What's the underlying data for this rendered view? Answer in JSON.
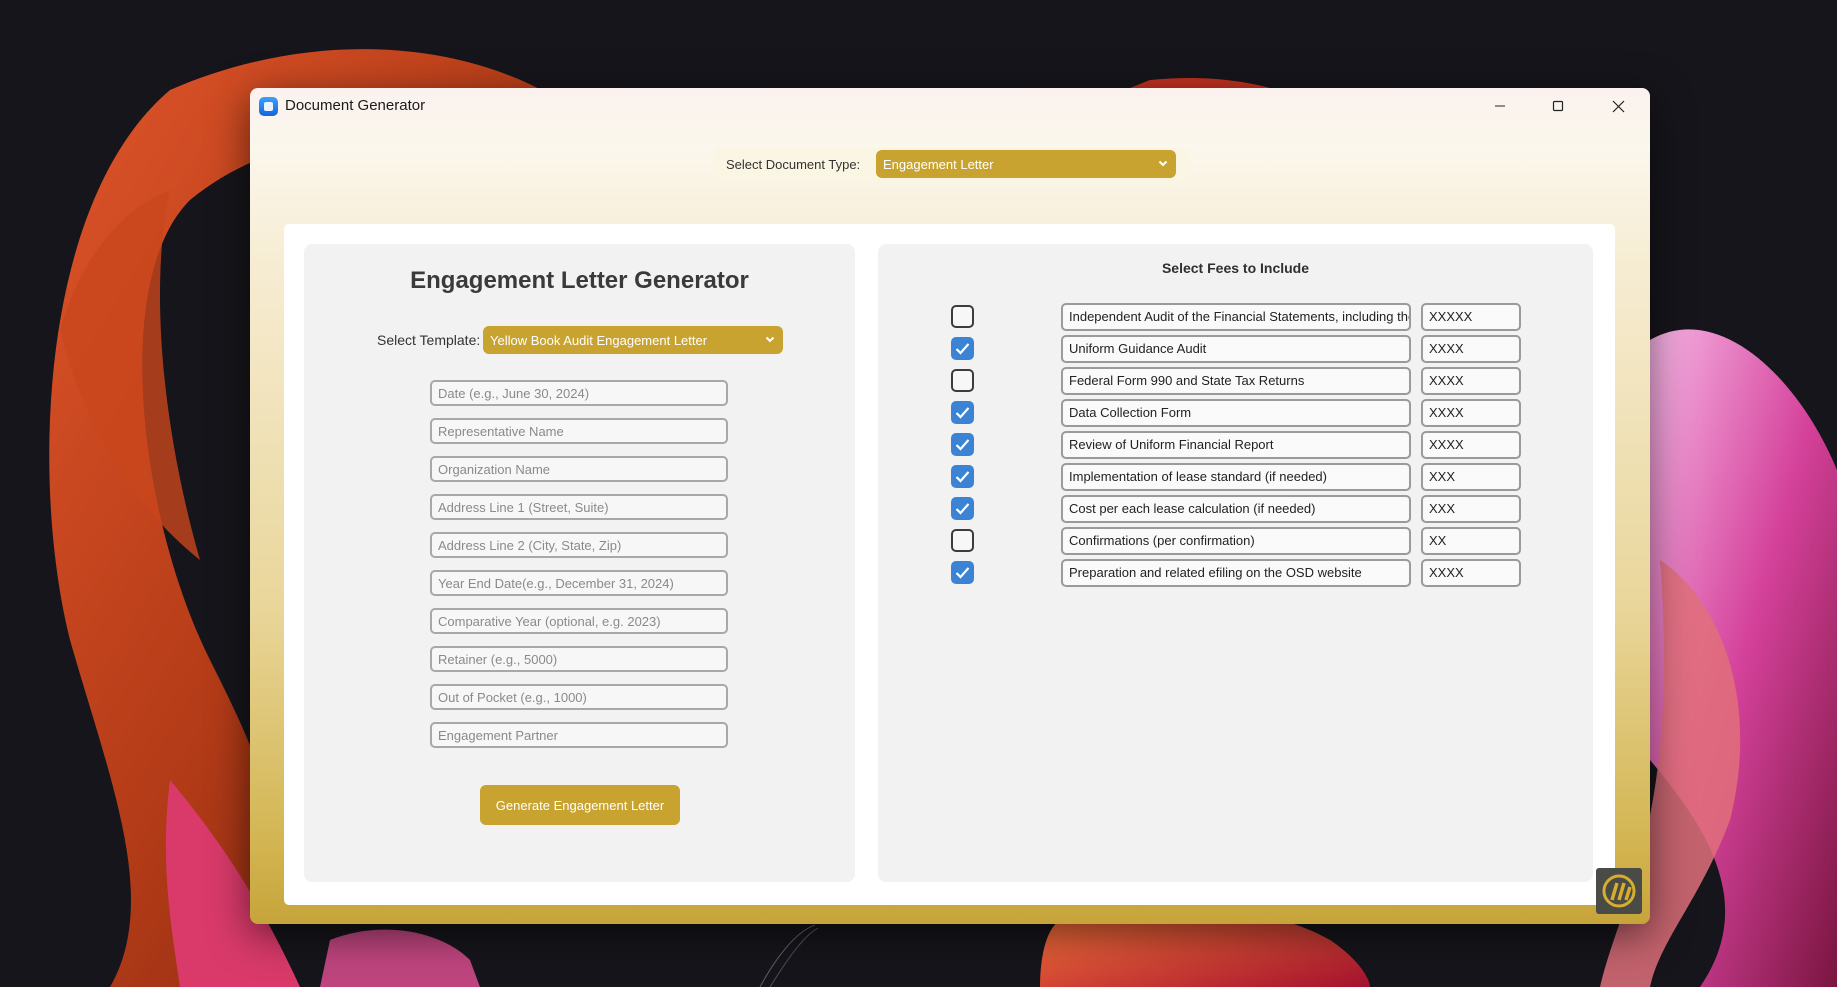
{
  "window": {
    "title": "Document Generator"
  },
  "doc_type": {
    "label": "Select Document Type:",
    "value": "Engagement Letter"
  },
  "left": {
    "title": "Engagement Letter Generator",
    "template_label": "Select Template:",
    "template_value": "Yellow Book Audit Engagement Letter",
    "fields": [
      {
        "placeholder": "Date (e.g., June 30, 2024)"
      },
      {
        "placeholder": "Representative Name"
      },
      {
        "placeholder": "Organization Name"
      },
      {
        "placeholder": "Address Line 1 (Street, Suite)"
      },
      {
        "placeholder": "Address Line 2 (City, State, Zip)"
      },
      {
        "placeholder": "Year End Date(e.g., December 31, 2024)"
      },
      {
        "placeholder": "Comparative Year (optional, e.g. 2023)"
      },
      {
        "placeholder": "Retainer (e.g., 5000)"
      },
      {
        "placeholder": "Out of Pocket (e.g., 1000)"
      },
      {
        "placeholder": "Engagement Partner"
      }
    ],
    "generate_label": "Generate Engagement Letter"
  },
  "fees": {
    "title": "Select Fees to Include",
    "items": [
      {
        "checked": false,
        "name": "Independent Audit of the Financial Statements, including the",
        "amount": "XXXXX"
      },
      {
        "checked": true,
        "name": "Uniform Guidance Audit",
        "amount": "XXXX"
      },
      {
        "checked": false,
        "name": "Federal Form 990 and State Tax Returns",
        "amount": "XXXX"
      },
      {
        "checked": true,
        "name": "Data Collection Form",
        "amount": "XXXX"
      },
      {
        "checked": true,
        "name": "Review of Uniform Financial Report",
        "amount": "XXXX"
      },
      {
        "checked": true,
        "name": "Implementation of lease standard (if needed)",
        "amount": "XXX"
      },
      {
        "checked": true,
        "name": "Cost per each lease calculation (if needed)",
        "amount": "XXX"
      },
      {
        "checked": false,
        "name": "Confirmations (per confirmation)",
        "amount": "XX"
      },
      {
        "checked": true,
        "name": "Preparation and related efiling on the OSD website",
        "amount": "XXXX"
      }
    ]
  },
  "colors": {
    "accent": "#c9a32f",
    "checkbox_checked": "#3b83d4"
  },
  "icons": {
    "app": "app-icon",
    "minimize": "minimize-icon",
    "maximize": "maximize-icon",
    "close": "close-icon",
    "dropdown": "chevron-down-icon",
    "check": "checkmark-icon",
    "logo": "company-logo"
  }
}
